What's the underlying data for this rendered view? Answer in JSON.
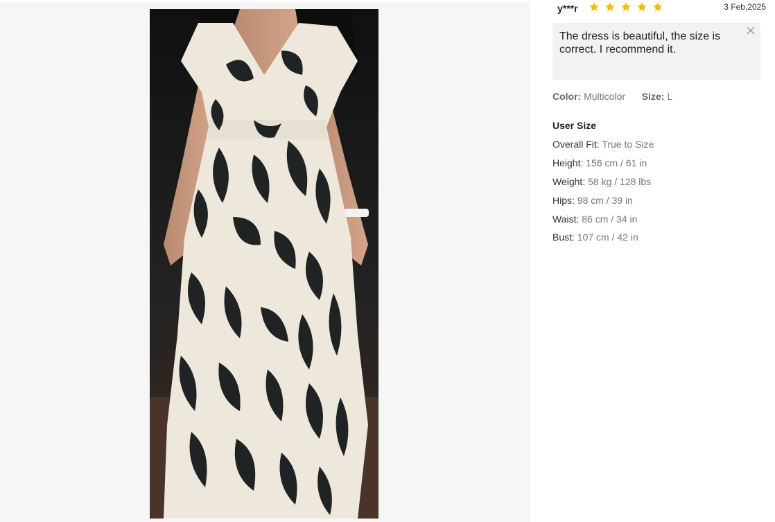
{
  "gallery": {
    "image_alt": "Customer photo of black and white leaf print wrap dress"
  },
  "review": {
    "reviewer": "y***r",
    "rating": 5,
    "star_color": "#f5b800",
    "date": "3 Feb,2025",
    "comment": "The dress is beautiful, the size is correct. I recommend it.",
    "close_icon": "close-icon"
  },
  "attributes": {
    "color_label": "Color:",
    "color_value": "Multicolor",
    "size_label": "Size:",
    "size_value": "L"
  },
  "user_size": {
    "title": "User Size",
    "rows": [
      {
        "label": "Overall Fit:",
        "value": "True to Size"
      },
      {
        "label": "Height:",
        "value": "156 cm / 61 in"
      },
      {
        "label": "Weight:",
        "value": "58 kg / 128 lbs"
      },
      {
        "label": "Hips:",
        "value": "98 cm / 39 in"
      },
      {
        "label": "Waist:",
        "value": "86 cm / 34 in"
      },
      {
        "label": "Bust:",
        "value": "107 cm / 42 in"
      }
    ]
  }
}
